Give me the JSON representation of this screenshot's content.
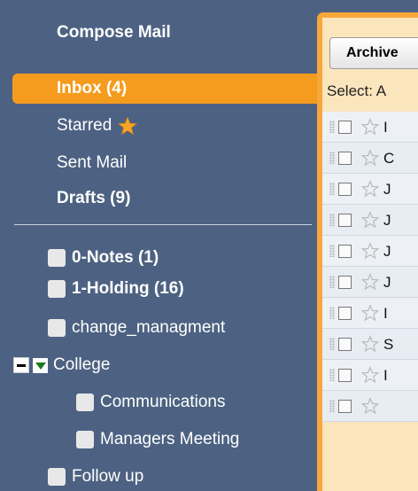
{
  "sidebar": {
    "compose_label": "Compose Mail",
    "nav": {
      "inbox": "Inbox (4)",
      "starred": "Starred",
      "sent": "Sent Mail",
      "drafts": "Drafts (9)"
    },
    "labels": [
      {
        "name": "0-Notes (1)"
      },
      {
        "name": "1-Holding (16)"
      },
      {
        "name": "change_managment"
      },
      {
        "name": "College"
      },
      {
        "name": "Communications"
      },
      {
        "name": "Managers Meeting"
      },
      {
        "name": "Follow up"
      }
    ]
  },
  "toolbar": {
    "archive_label": "Archive",
    "select_label": "Select: A"
  },
  "message_rows": [
    {
      "letter": "I"
    },
    {
      "letter": "C"
    },
    {
      "letter": "J"
    },
    {
      "letter": "J"
    },
    {
      "letter": "J"
    },
    {
      "letter": "J"
    },
    {
      "letter": "I"
    },
    {
      "letter": "S"
    },
    {
      "letter": "I"
    },
    {
      "letter": ""
    }
  ],
  "colors": {
    "sidebar_bg": "#4d6282",
    "accent": "#f59b1e",
    "star": "#f6a623"
  }
}
